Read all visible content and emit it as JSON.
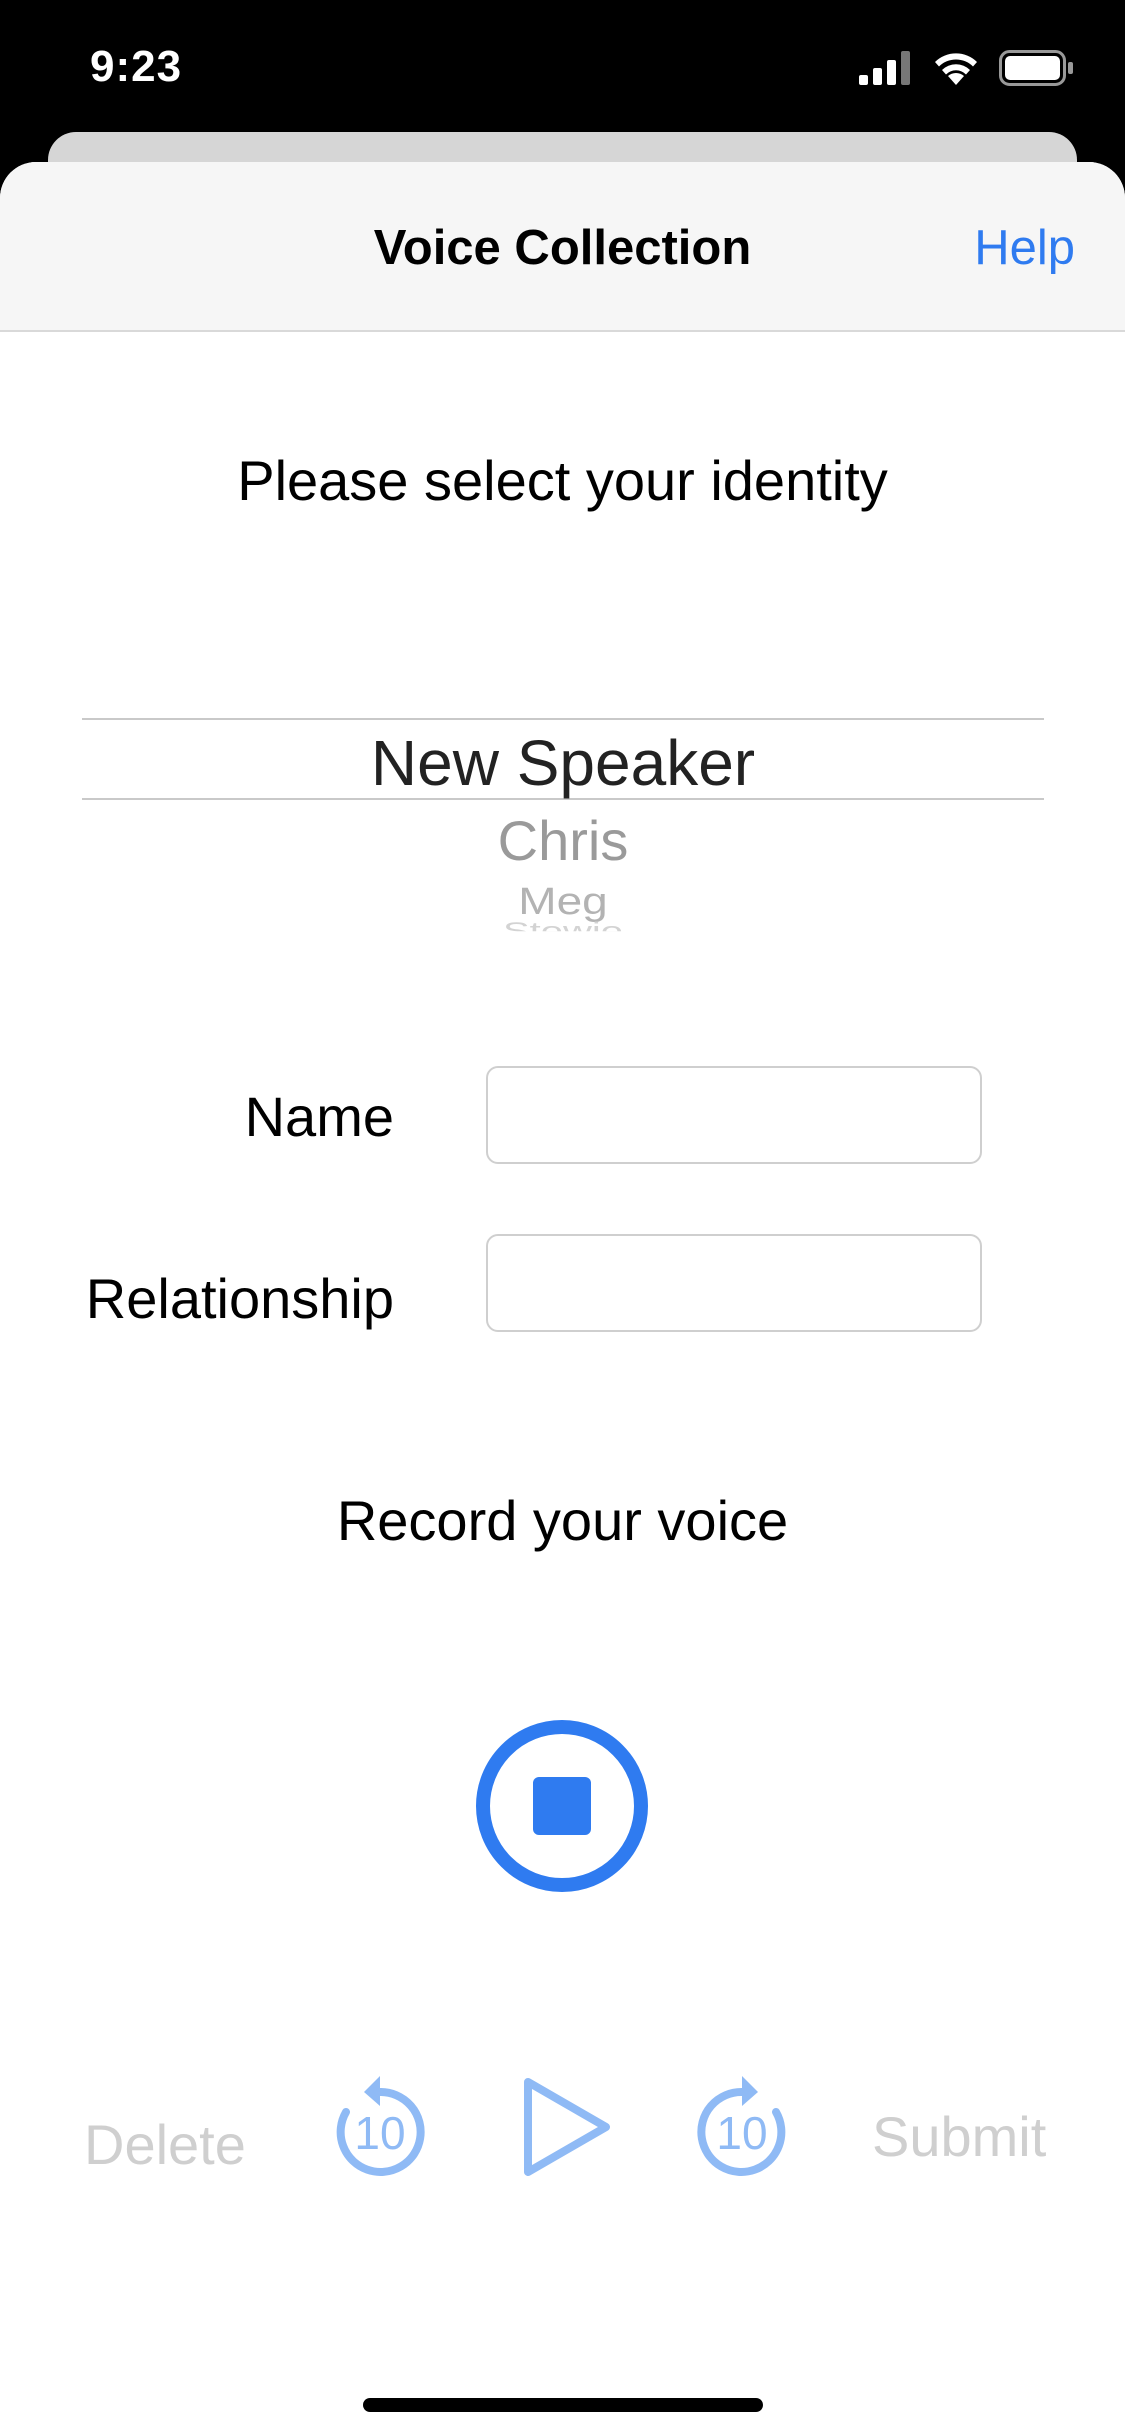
{
  "status_bar": {
    "time": "9:23"
  },
  "nav": {
    "title": "Voice Collection",
    "help_label": "Help"
  },
  "identity": {
    "prompt": "Please select your identity",
    "picker_items": [
      "New Speaker",
      "Chris",
      "Meg",
      "Stewie"
    ],
    "selected": "New Speaker"
  },
  "form": {
    "name_label": "Name",
    "name_value": "",
    "relationship_label": "Relationship",
    "relationship_value": ""
  },
  "record": {
    "prompt": "Record your voice"
  },
  "controls": {
    "delete_label": "Delete",
    "rewind_seconds": "10",
    "forward_seconds": "10",
    "submit_label": "Submit"
  },
  "colors": {
    "accent": "#2f7bf0",
    "disabled": "#cfcfcf",
    "disabled_icon": "#8fbaf5"
  },
  "icons": [
    "signal-icon",
    "wifi-icon",
    "battery-icon",
    "stop-icon",
    "rewind-10-icon",
    "play-icon",
    "forward-10-icon"
  ]
}
